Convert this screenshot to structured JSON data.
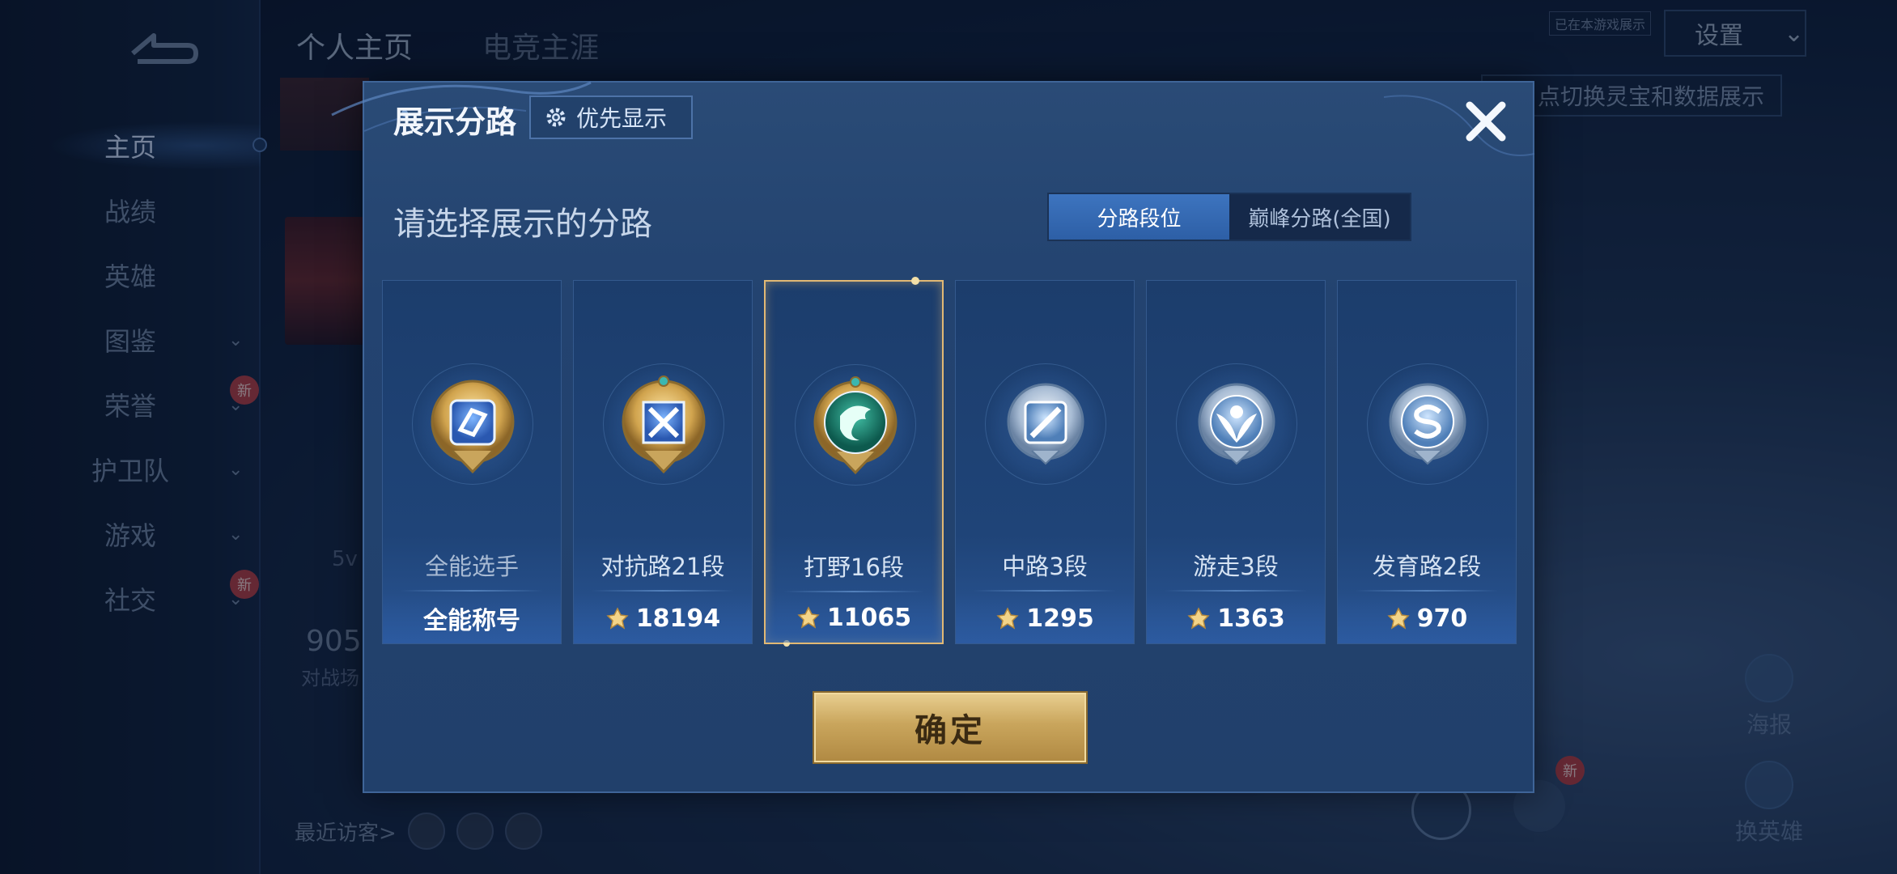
{
  "background": {
    "sidebar": {
      "items": [
        {
          "label": "主页",
          "active": true,
          "chevron": false,
          "badge": ""
        },
        {
          "label": "战绩",
          "active": false,
          "chevron": false,
          "badge": ""
        },
        {
          "label": "英雄",
          "active": false,
          "chevron": false,
          "badge": ""
        },
        {
          "label": "图鉴",
          "active": false,
          "chevron": true,
          "badge": ""
        },
        {
          "label": "荣誉",
          "active": false,
          "chevron": true,
          "badge": "新"
        },
        {
          "label": "护卫队",
          "active": false,
          "chevron": true,
          "badge": ""
        },
        {
          "label": "游戏",
          "active": false,
          "chevron": true,
          "badge": ""
        },
        {
          "label": "社交",
          "active": false,
          "chevron": true,
          "badge": "新"
        }
      ]
    },
    "tabs": {
      "personal": "个人主页",
      "esports": "电竞主涯"
    },
    "settings": {
      "label": "设置",
      "tag": "已在本游戏展示"
    },
    "hint": "点切换灵宝和数据展示",
    "stats": {
      "value": "905",
      "sub": "对战场",
      "mode": "5v"
    },
    "visitors_label": "最近访客>",
    "right_buttons": {
      "poster": "海报",
      "change_hero": "换英雄"
    },
    "new_badge": "新"
  },
  "modal": {
    "title": "展示分路",
    "priority_label": "优先显示",
    "subtitle": "请选择展示的分路",
    "toggle": {
      "left": "分路段位",
      "right": "巅峰分路(全国)",
      "active": "left"
    },
    "cards": [
      {
        "name": "全能选手",
        "footer": "全能称号",
        "has_score_icon": false,
        "badge": "allround",
        "selected": false
      },
      {
        "name": "对抗路21段",
        "footer": "18194",
        "has_score_icon": true,
        "badge": "clash",
        "selected": false
      },
      {
        "name": "打野16段",
        "footer": "11065",
        "has_score_icon": true,
        "badge": "jungle",
        "selected": true
      },
      {
        "name": "中路3段",
        "footer": "1295",
        "has_score_icon": true,
        "badge": "mid",
        "selected": false
      },
      {
        "name": "游走3段",
        "footer": "1363",
        "has_score_icon": true,
        "badge": "roam",
        "selected": false
      },
      {
        "name": "发育路2段",
        "footer": "970",
        "has_score_icon": true,
        "badge": "farm",
        "selected": false
      }
    ],
    "confirm_label": "确定"
  },
  "colors": {
    "accent_gold": "#e1b874",
    "toggle_active": "#3d74bf",
    "modal_bg": "#234370"
  }
}
